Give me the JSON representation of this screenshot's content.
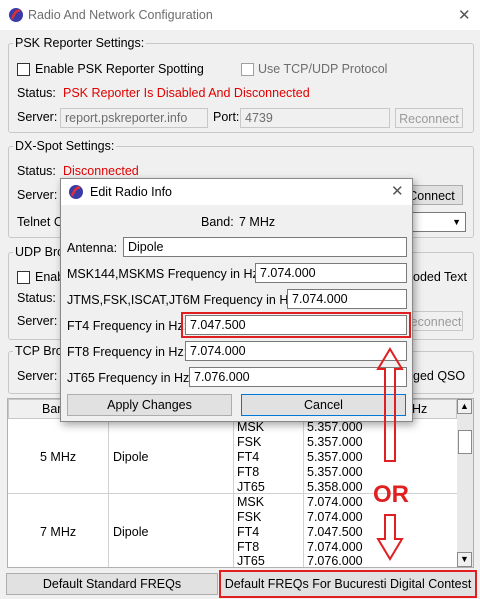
{
  "window": {
    "title": "Radio And Network Configuration"
  },
  "psk": {
    "legend": "PSK Reporter Settings:",
    "enable_label": "Enable PSK Reporter Spotting",
    "tcp_label": "Use TCP/UDP Protocol",
    "status_label": "Status:",
    "status_text": "PSK Reporter Is Disabled And Disconnected",
    "server_label": "Server:",
    "server_value": "report.pskreporter.info",
    "port_label": "Port:",
    "port_value": "4739",
    "reconnect_label": "Reconnect"
  },
  "dx": {
    "legend": "DX-Spot Settings:",
    "status_label": "Status:",
    "status_text": "Disconnected",
    "server_label": "Server:",
    "telnet_label": "Telnet C",
    "connect_label": "Connect"
  },
  "udp": {
    "legend": "UDP Bro",
    "enable_label": "Enab",
    "decoded_label": "oded Text",
    "status_label": "Status:",
    "server_label": "Server:",
    "reconnect_label": "Reconnect"
  },
  "tcp": {
    "legend": "TCP Bro",
    "server_label": "Server:",
    "logged_label": "ged QSO"
  },
  "dialog": {
    "title": "Edit Radio Info",
    "band_label": "Band:",
    "band_value": "7 MHz",
    "antenna_label": "Antenna:",
    "antenna_value": "Dipole",
    "rows": [
      {
        "label": "MSK144,MSKMS Frequency in Hz:",
        "value": "7.074.000"
      },
      {
        "label": "JTMS,FSK,ISCAT,JT6M Frequency in Hz:",
        "value": "7.074.000"
      },
      {
        "label": "FT4 Frequency in Hz:",
        "value": "7.047.500"
      },
      {
        "label": "FT8 Frequency in Hz:",
        "value": "7.074.000"
      },
      {
        "label": "JT65 Frequency in Hz:",
        "value": "7.076.000"
      }
    ],
    "apply_label": "Apply Changes",
    "cancel_label": "Cancel"
  },
  "grid": {
    "header_band": "Bar",
    "header_freq": "Hz",
    "groups": [
      {
        "band": "5 MHz",
        "antenna": "Dipole",
        "rows": [
          [
            "MSK",
            "5.357.000"
          ],
          [
            "FSK",
            "5.357.000"
          ],
          [
            "FT4",
            "5.357.000"
          ],
          [
            "FT8",
            "5.357.000"
          ],
          [
            "JT65",
            "5.358.000"
          ]
        ]
      },
      {
        "band": "7 MHz",
        "antenna": "Dipole",
        "rows": [
          [
            "MSK",
            "7.074.000"
          ],
          [
            "FSK",
            "7.074.000"
          ],
          [
            "FT4",
            "7.047.500"
          ],
          [
            "FT8",
            "7.074.000"
          ],
          [
            "JT65",
            "7.076.000"
          ]
        ]
      }
    ]
  },
  "annotation": {
    "or_text": "OR",
    "color": "#e02020"
  },
  "bottom": {
    "default_label": "Default Standard FREQs",
    "bucuresti_label": "Default FREQs For Bucuresti Digital Contest"
  },
  "colors": {
    "status_red": "#e00000",
    "annotation_red": "#e02020"
  }
}
